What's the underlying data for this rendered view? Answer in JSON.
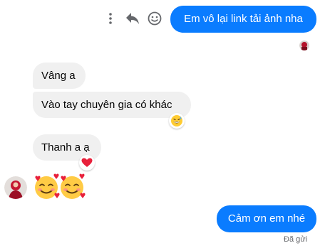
{
  "toolbar": {
    "more_icon": "vertical-ellipsis-icon",
    "forward_icon": "reply-arrow-icon",
    "react_icon": "smiley-icon"
  },
  "messages": [
    {
      "direction": "outgoing",
      "text": "Em vô lại link tải ảnh nha"
    },
    {
      "direction": "incoming",
      "text": "Vâng a"
    },
    {
      "direction": "incoming",
      "text": "Vào tay chuyên gia có khác",
      "reaction": "grinning-sweat-emoji"
    },
    {
      "direction": "incoming",
      "text": "Thanh a ạ",
      "reaction": "red-heart-emoji"
    },
    {
      "direction": "incoming",
      "emoji": [
        "smiling-face-with-hearts-emoji",
        "smiling-face-with-hearts-emoji"
      ]
    },
    {
      "direction": "outgoing",
      "text": "Cảm ơn em nhé"
    }
  ],
  "status": {
    "text": "Đã gửi"
  },
  "colors": {
    "outgoing_bubble": "#0a7cff",
    "incoming_bubble": "#f0f0f0",
    "reaction_heart": "#e8213b"
  }
}
